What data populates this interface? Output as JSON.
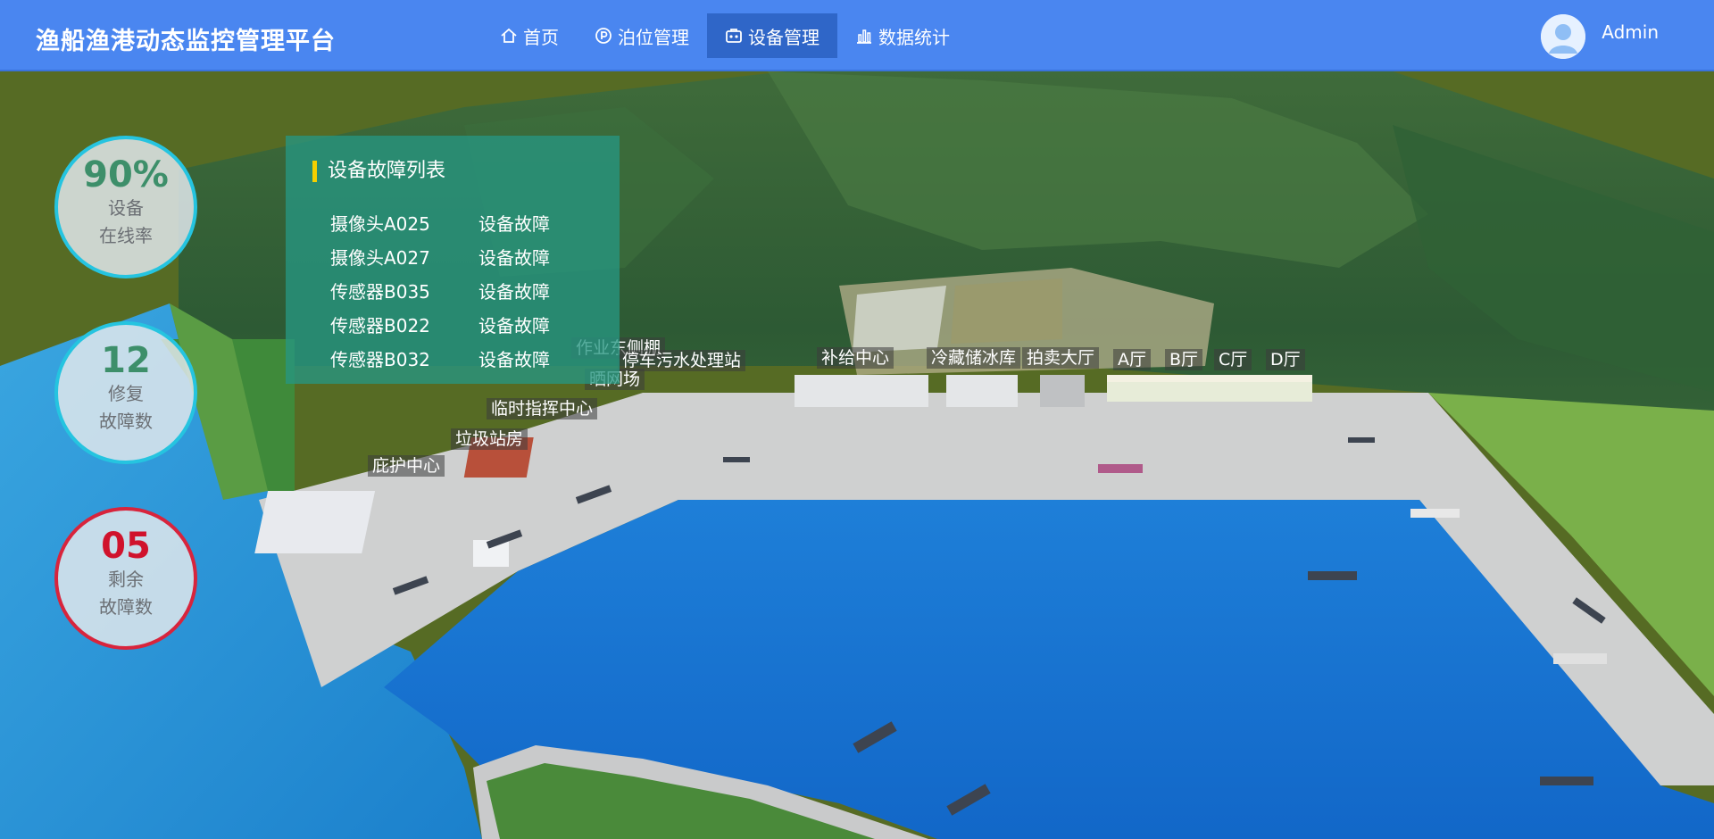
{
  "header": {
    "title": "渔船渔港动态监控管理平台",
    "nav": [
      {
        "label": "首页",
        "icon": "home-icon",
        "active": false
      },
      {
        "label": "泊位管理",
        "icon": "parking-icon",
        "active": false
      },
      {
        "label": "设备管理",
        "icon": "device-icon",
        "active": true
      },
      {
        "label": "数据统计",
        "icon": "bar-chart-icon",
        "active": false
      }
    ],
    "user": {
      "name": "Admin",
      "icon": "user-avatar-icon"
    }
  },
  "stats": [
    {
      "value": "90%",
      "label_line1": "设备",
      "label_line2": "在线率",
      "color": "#3d8f6a",
      "ring": "#25c4e0"
    },
    {
      "value": "12",
      "label_line1": "修复",
      "label_line2": "故障数",
      "color": "#3d8f6a",
      "ring": "#25c4e0"
    },
    {
      "value": "05",
      "label_line1": "剩余",
      "label_line2": "故障数",
      "color": "#d0122c",
      "ring": "#d8243c"
    }
  ],
  "fault_panel": {
    "title": "设备故障列表",
    "items": [
      {
        "name": "摄像头A025",
        "status": "设备故障"
      },
      {
        "name": "摄像头A027",
        "status": "设备故障"
      },
      {
        "name": "传感器B035",
        "status": "设备故障"
      },
      {
        "name": "传感器B022",
        "status": "设备故障"
      },
      {
        "name": "传感器B032",
        "status": "设备故障"
      }
    ]
  },
  "map_labels": {
    "work_shed": "作业东侧棚",
    "sewage": "停车污水处理站",
    "drying": "晒网场",
    "command": "临时指挥中心",
    "garbage": "垃圾站房",
    "shelter": "庇护中心",
    "supply": "补给中心",
    "cold_storage": "冷藏储冰库",
    "auction": "拍卖大厅",
    "hall_a": "A厅",
    "hall_b": "B厅",
    "hall_c": "C厅",
    "hall_d": "D厅"
  },
  "colors": {
    "header_bg": "#4a86f0",
    "nav_active": "#2f66c8",
    "water": "#1474d8",
    "panel_bg": "#2696a0",
    "panel_accent": "#f5d000"
  }
}
